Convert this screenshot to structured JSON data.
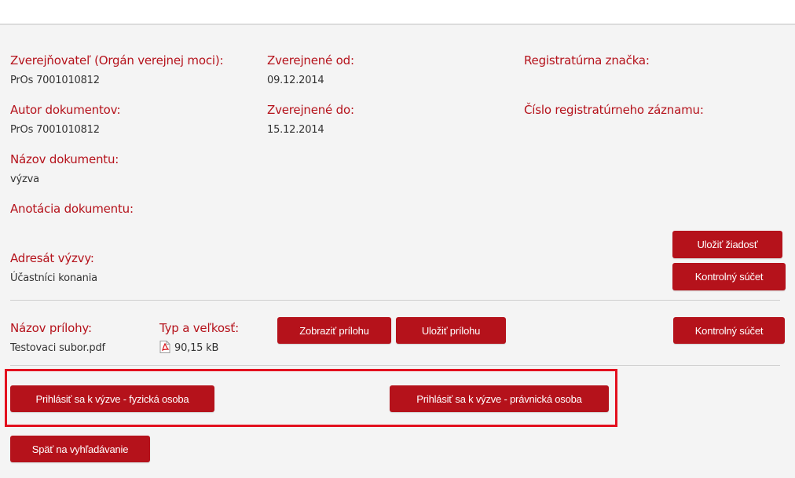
{
  "fields": {
    "publisher": {
      "label": "Zverejňovateľ (Orgán verejnej moci):",
      "value": "PrOs 7001010812"
    },
    "published_from": {
      "label": "Zverejnené od:",
      "value": "09.12.2014"
    },
    "registry_mark": {
      "label": "Registratúrna značka:"
    },
    "author": {
      "label": "Autor dokumentov:",
      "value": "PrOs 7001010812"
    },
    "published_to": {
      "label": "Zverejnené do:",
      "value": "15.12.2014"
    },
    "registry_record_number": {
      "label": "Číslo registratúrneho záznamu:"
    },
    "document_name": {
      "label": "Názov dokumentu:",
      "value": "výzva"
    },
    "document_annotation": {
      "label": "Anotácia dokumentu:"
    },
    "addressee": {
      "label": "Adresát výzvy:",
      "value": "Účastníci konania"
    }
  },
  "actions": {
    "save_request": "Uložiť žiadosť",
    "checksum": "Kontrolný súčet"
  },
  "attachment": {
    "name_label": "Názov prílohy:",
    "name_value": "Testovaci subor.pdf",
    "type_label": "Typ a veľkosť:",
    "size_value": "90,15 kB",
    "file_icon": "pdf-icon",
    "show_button": "Zobraziť prílohu",
    "save_button": "Uložiť prílohu",
    "checksum_button": "Kontrolný súčet"
  },
  "signup": {
    "natural_person": "Prihlásiť sa k výzve - fyzická osoba",
    "legal_person": "Prihlásiť sa k výzve - právnická osoba"
  },
  "navigation": {
    "back_to_search": "Späť na vyhľadávanie"
  },
  "colors": {
    "accent": "#b5121b",
    "highlight": "#e3101e",
    "background": "#f4f4f4"
  }
}
